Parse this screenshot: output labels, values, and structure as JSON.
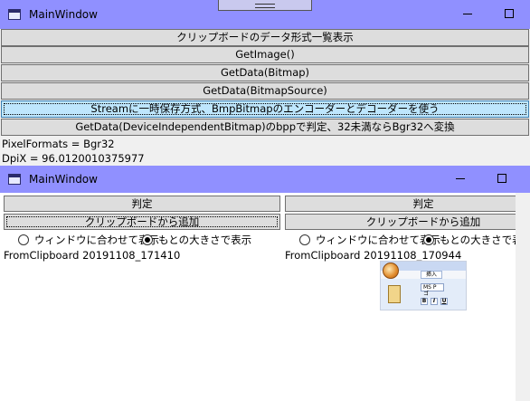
{
  "main_window": {
    "title": "MainWindow",
    "buttons": [
      "クリップボードのデータ形式一覧表示",
      "GetImage()",
      "GetData(Bitmap)",
      "GetData(BitmapSource)",
      "Streamに一時保存方式、BmpBitmapのエンコーダーとデコーダーを使う",
      "GetData(DeviceIndependentBitmap)のbppで判定、32未満ならBgr32へ変換"
    ],
    "info_lines": [
      "PixelFormats = Bgr32",
      "DpiX = 96.0120010375977"
    ]
  },
  "child_window": {
    "title": "MainWindow",
    "panes": [
      {
        "judge_label": "判定",
        "add_label": "クリップボードから追加",
        "radio_fit_label": "ウィンドウに合わせて表示",
        "radio_original_label": "もとの大きさで表示",
        "selected_radio": "original",
        "caption": "FromClipboard 20191108_171410"
      },
      {
        "judge_label": "判定",
        "add_label": "クリップボードから追加",
        "radio_fit_label": "ウィンドウに合わせて表示",
        "radio_original_label": "もとの大きさで表示",
        "selected_radio": "original",
        "caption": "FromClipboard 20191108_170944",
        "thumbnail": {
          "tab_label": "挿入",
          "font_size_text": "MS P ゴ",
          "bold_label": "B",
          "italic_label": "I",
          "underline_label": "U"
        }
      }
    ]
  },
  "colors": {
    "titlebar": "#9090ff",
    "focused_button": "#bee6fd",
    "button": "#dddddd"
  },
  "icons": [
    "window-icon",
    "minimize-icon",
    "maximize-icon",
    "close-icon",
    "radio-icon"
  ]
}
